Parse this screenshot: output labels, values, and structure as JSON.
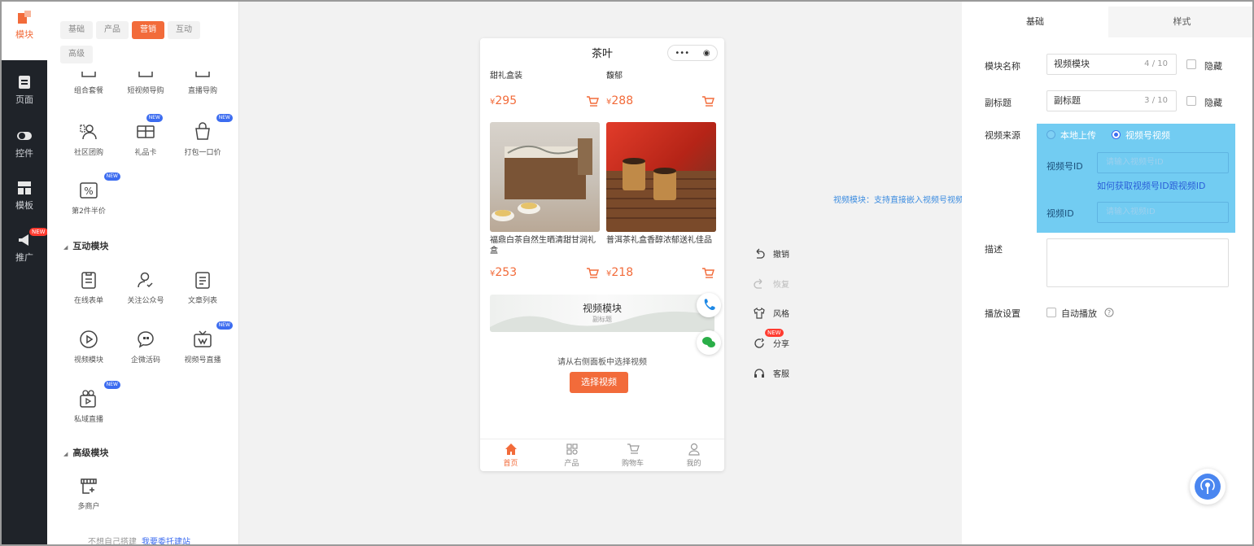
{
  "nav": [
    {
      "label": "模块",
      "icon": "module-icon",
      "active": true,
      "badge": ""
    },
    {
      "label": "页面",
      "icon": "page-icon",
      "active": false,
      "badge": ""
    },
    {
      "label": "控件",
      "icon": "toggle-icon",
      "active": false,
      "badge": ""
    },
    {
      "label": "模板",
      "icon": "template-icon",
      "active": false,
      "badge": ""
    },
    {
      "label": "推广",
      "icon": "megaphone-icon",
      "active": false,
      "badge": "NEW"
    }
  ],
  "module_tabs": [
    "基础",
    "产品",
    "营销",
    "互动",
    "高级"
  ],
  "module_tabs_active": "营销",
  "marketing_items": [
    {
      "label": "组合套餐",
      "icon": "bundle-icon",
      "new": false
    },
    {
      "label": "短视频导购",
      "icon": "short-video-icon",
      "new": false
    },
    {
      "label": "直播导购",
      "icon": "live-guide-icon",
      "new": false
    },
    {
      "label": "社区团购",
      "icon": "community-group-icon",
      "new": false
    },
    {
      "label": "礼品卡",
      "icon": "gift-card-icon",
      "new": true
    },
    {
      "label": "打包一口价",
      "icon": "package-price-icon",
      "new": true
    },
    {
      "label": "第2件半价",
      "icon": "half-price-icon",
      "new": true
    }
  ],
  "interact_section": "互动模块",
  "interact_items": [
    {
      "label": "在线表单",
      "icon": "form-icon",
      "new": false
    },
    {
      "label": "关注公众号",
      "icon": "follow-icon",
      "new": false
    },
    {
      "label": "文章列表",
      "icon": "article-list-icon",
      "new": false
    },
    {
      "label": "视频模块",
      "icon": "video-icon",
      "new": false
    },
    {
      "label": "企微活码",
      "icon": "wecom-code-icon",
      "new": false
    },
    {
      "label": "视频号直播",
      "icon": "channel-live-icon",
      "new": true
    },
    {
      "label": "私域直播",
      "icon": "private-live-icon",
      "new": true
    }
  ],
  "advanced_section": "高级模块",
  "advanced_items": [
    {
      "label": "多商户",
      "icon": "multi-merchant-icon",
      "new": false
    }
  ],
  "footer": {
    "text": "不想自己搭建",
    "link": "我要委托建站"
  },
  "phone": {
    "title": "茶叶",
    "capsule_more": "•••",
    "top_products": [
      {
        "name": "甜礼盒装",
        "price": "295"
      },
      {
        "name": "馥郁",
        "price": "288"
      }
    ],
    "products": [
      {
        "name": "福鼎白茶自然生晒清甜甘润礼盒",
        "price": "253"
      },
      {
        "name": "普洱茶礼盒香醇浓郁送礼佳品",
        "price": "218"
      }
    ],
    "currency": "¥",
    "video_title": "视频模块",
    "video_subtitle": "副标题",
    "hint": "请从右侧面板中选择视频",
    "select_button": "选择视频",
    "tabbar": [
      {
        "label": "首页",
        "icon": "home-icon",
        "active": true
      },
      {
        "label": "产品",
        "icon": "product-grid-icon",
        "active": false
      },
      {
        "label": "购物车",
        "icon": "cart-icon",
        "active": false
      },
      {
        "label": "我的",
        "icon": "user-icon",
        "active": false
      }
    ]
  },
  "toolbar": [
    {
      "label": "撤销",
      "icon": "undo-icon",
      "disabled": false,
      "badge": ""
    },
    {
      "label": "恢复",
      "icon": "redo-icon",
      "disabled": true,
      "badge": ""
    },
    {
      "label": "风格",
      "icon": "shirt-icon",
      "disabled": false,
      "badge": ""
    },
    {
      "label": "分享",
      "icon": "share-icon",
      "disabled": false,
      "badge": "NEW"
    },
    {
      "label": "客服",
      "icon": "headset-icon",
      "disabled": false,
      "badge": ""
    }
  ],
  "annotation": "视频模块：支持直接嵌入视频号视频",
  "right": {
    "tabs": [
      "基础",
      "样式"
    ],
    "name_label": "模块名称",
    "name_value": "视频模块",
    "name_count": "4 / 10",
    "subtitle_label": "副标题",
    "subtitle_value": "副标题",
    "subtitle_count": "3 / 10",
    "hide_label": "隐藏",
    "source_label": "视频来源",
    "source_options": [
      "本地上传",
      "视频号视频"
    ],
    "source_selected": "视频号视频",
    "channel_id_label": "视频号ID",
    "channel_id_placeholder": "请输入视频号ID",
    "how_to_link": "如何获取视频号ID跟视频ID",
    "video_id_label": "视频ID",
    "video_id_placeholder": "请输入视频ID",
    "desc_label": "描述",
    "play_label": "播放设置",
    "autoplay_label": "自动播放"
  },
  "colors": {
    "accent": "#f26b3a",
    "nav_bg": "#1f2329",
    "highlight": "#72ccf2",
    "link": "#2a5fd8"
  }
}
